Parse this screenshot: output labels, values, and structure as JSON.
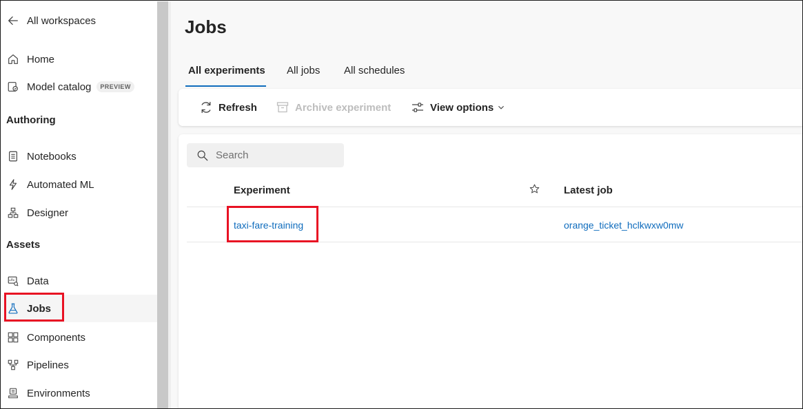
{
  "sidebar": {
    "back_label": "All workspaces",
    "items_top": [
      {
        "label": "Home",
        "icon": "home-icon"
      },
      {
        "label": "Model catalog",
        "icon": "model-catalog-icon",
        "badge": "PREVIEW"
      }
    ],
    "section_authoring": "Authoring",
    "items_authoring": [
      {
        "label": "Notebooks",
        "icon": "notebook-icon"
      },
      {
        "label": "Automated ML",
        "icon": "automated-ml-icon"
      },
      {
        "label": "Designer",
        "icon": "designer-icon"
      }
    ],
    "section_assets": "Assets",
    "items_assets": [
      {
        "label": "Data",
        "icon": "data-icon"
      },
      {
        "label": "Jobs",
        "icon": "flask-icon",
        "active": true
      },
      {
        "label": "Components",
        "icon": "components-icon"
      },
      {
        "label": "Pipelines",
        "icon": "pipelines-icon"
      },
      {
        "label": "Environments",
        "icon": "environments-icon"
      }
    ]
  },
  "main": {
    "title": "Jobs",
    "tabs": [
      {
        "label": "All experiments",
        "active": true
      },
      {
        "label": "All jobs"
      },
      {
        "label": "All schedules"
      }
    ],
    "toolbar": {
      "refresh_label": "Refresh",
      "archive_label": "Archive experiment",
      "view_options_label": "View options"
    },
    "search": {
      "placeholder": "Search",
      "value": ""
    },
    "table": {
      "columns": [
        "Experiment",
        "Latest job"
      ],
      "rows": [
        {
          "experiment": "taxi-fare-training",
          "latest_job": "orange_ticket_hclkwxw0mw"
        }
      ]
    }
  },
  "colors": {
    "accent": "#0f6cbd",
    "highlight": "#e81123",
    "scrollbar": "#c8c8c8"
  }
}
